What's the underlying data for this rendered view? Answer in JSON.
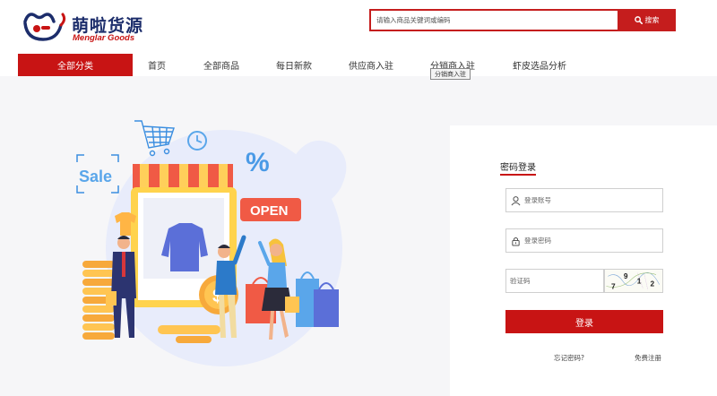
{
  "brand": {
    "name_cn": "萌啦货源",
    "name_en": "Menglar Goods",
    "accent": "#c81414",
    "navy": "#1c2d6b"
  },
  "search": {
    "placeholder": "请输入商品关键词或编码",
    "button_label": "搜索",
    "icon": "search-icon"
  },
  "nav": {
    "all_label": "全部分类",
    "items": [
      "首页",
      "全部商品",
      "每日新款",
      "供应商入驻",
      "分销商入驻",
      "虾皮选品分析"
    ],
    "tooltip": "分销商入驻"
  },
  "illustration": {
    "sale_text": "Sale",
    "open_text": "OPEN",
    "percent_text": "%"
  },
  "login": {
    "title": "密码登录",
    "account_placeholder": "登录账号",
    "password_placeholder": "登录密码",
    "captcha_placeholder": "验证码",
    "captcha_chars": [
      "9",
      "1",
      "2",
      "7"
    ],
    "submit_label": "登录",
    "forgot_label": "忘记密码?",
    "register_label": "免费注册"
  }
}
